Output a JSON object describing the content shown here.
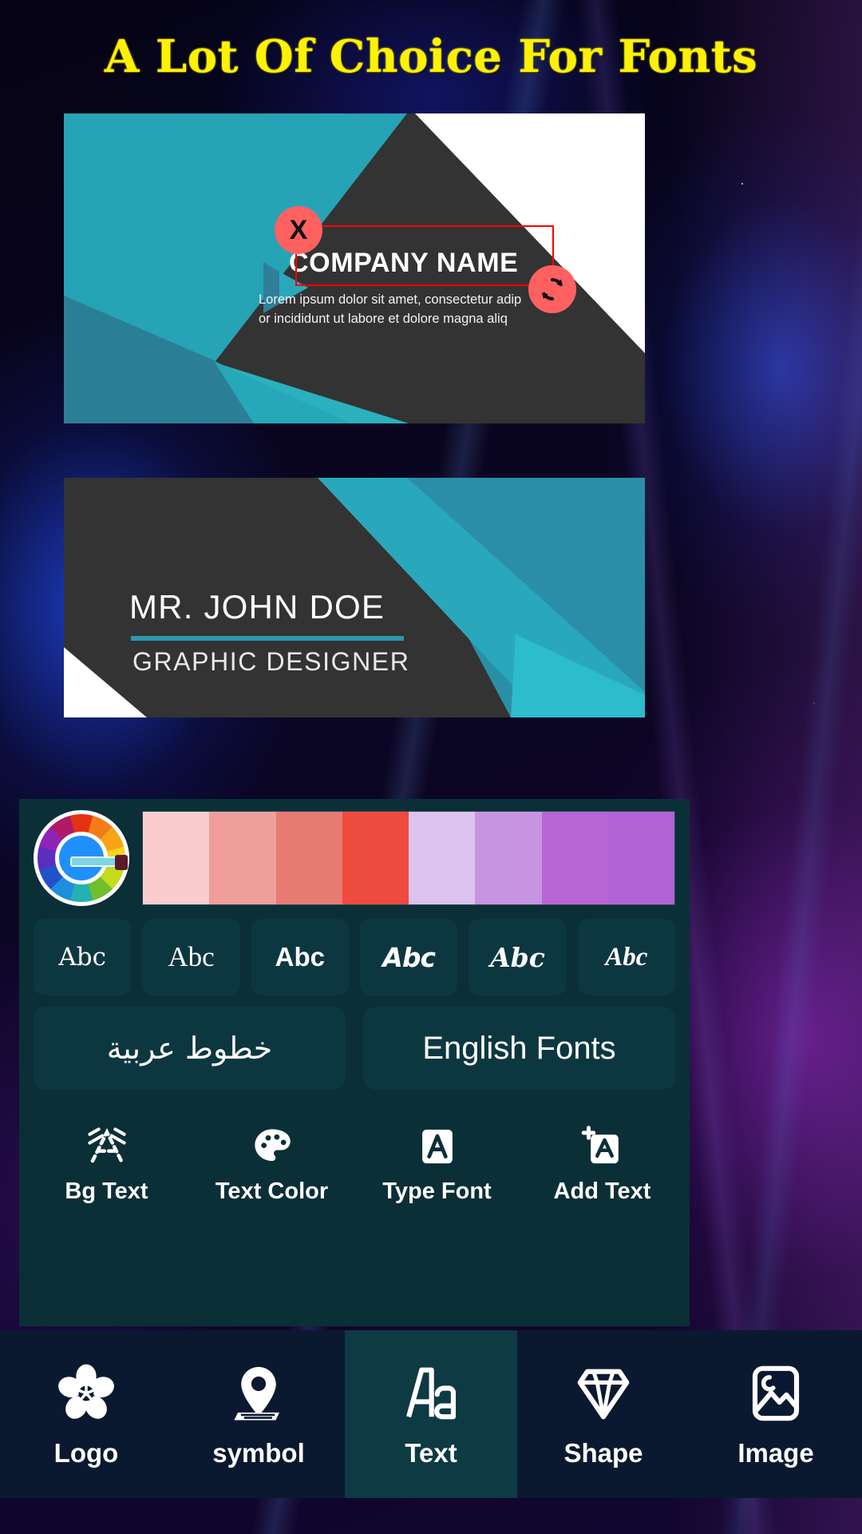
{
  "headline": "A Lot Of Choice For Fonts",
  "canvas": {
    "card_front": {
      "company_name": "COMPANY NAME",
      "tagline_line_1": "Lorem ipsum dolor sit amet, consectetur adip",
      "tagline_line_2": "or incididunt ut labore et dolore magna aliq",
      "selection": {
        "delete_handle_label": "X",
        "rotate_handle_icon": "rotate-icon"
      }
    },
    "card_back": {
      "person_name": "MR. JOHN DOE",
      "job_title": "GRAPHIC DESIGNER"
    }
  },
  "editor": {
    "color_picker": {
      "wheel_icon": "color-wheel-eyedropper-icon",
      "swatches": [
        "#f9cdcd",
        "#ef9e9b",
        "#e77b74",
        "#ef4a3e",
        "#dcc2ee",
        "#c694e0",
        "#b866d6",
        "#b264d4"
      ]
    },
    "font_samples": [
      {
        "label": "Abc",
        "style": "serif-light"
      },
      {
        "label": "Abc",
        "style": "serif-regular"
      },
      {
        "label": "Abc",
        "style": "sans-bold"
      },
      {
        "label": "Abc",
        "style": "sans-bold-italic"
      },
      {
        "label": "Abc",
        "style": "serif-bold-italic"
      },
      {
        "label": "Abc",
        "style": "script-italic"
      }
    ],
    "language_buttons": [
      {
        "label": "خطوط عربية",
        "name": "arabic-fonts"
      },
      {
        "label": "English Fonts",
        "name": "english-fonts"
      }
    ],
    "text_tools": [
      {
        "label": "Bg Text",
        "icon": "bg-text-icon",
        "active": false
      },
      {
        "label": "Text Color",
        "icon": "palette-icon",
        "active": false
      },
      {
        "label": "Type Font",
        "icon": "type-font-icon",
        "active": false
      },
      {
        "label": "Add Text",
        "icon": "add-text-icon",
        "active": false
      }
    ]
  },
  "bottom_nav": [
    {
      "label": "Logo",
      "icon": "flower-icon",
      "active": false
    },
    {
      "label": "symbol",
      "icon": "map-pin-icon",
      "active": false
    },
    {
      "label": "Text",
      "icon": "text-aa-icon",
      "active": true
    },
    {
      "label": "Shape",
      "icon": "diamond-icon",
      "active": false
    },
    {
      "label": "Image",
      "icon": "image-icon",
      "active": false
    }
  ],
  "colors": {
    "accent_yellow": "#fff200",
    "panel_bg": "#0b2f36",
    "chip_bg": "#0d3740",
    "nav_bg": "#0b1930",
    "nav_active": "#0e3a44",
    "selection_red": "#ff0000",
    "handle_red": "#ff6161",
    "card_teal": "#26a3b5",
    "card_dark": "#333333"
  }
}
